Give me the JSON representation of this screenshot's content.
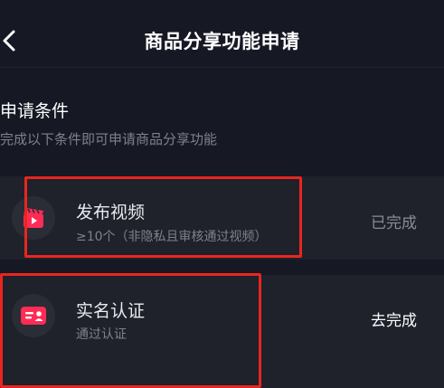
{
  "header": {
    "title": "商品分享功能申请"
  },
  "conditions": {
    "title": "申请条件",
    "subtitle": "完成以下条件即可申请商品分享功能"
  },
  "items": [
    {
      "title": "发布视频",
      "subtitle": "≥10个（非隐私且审核通过视频）",
      "status": "已完成",
      "icon": "video-clapper-icon"
    },
    {
      "title": "实名认证",
      "subtitle": "通过认证",
      "status": "去完成",
      "icon": "id-card-icon"
    }
  ],
  "colors": {
    "background": "#161823",
    "card": "#1f212b",
    "accent": "#fe2c55",
    "highlight": "#e8261f"
  }
}
